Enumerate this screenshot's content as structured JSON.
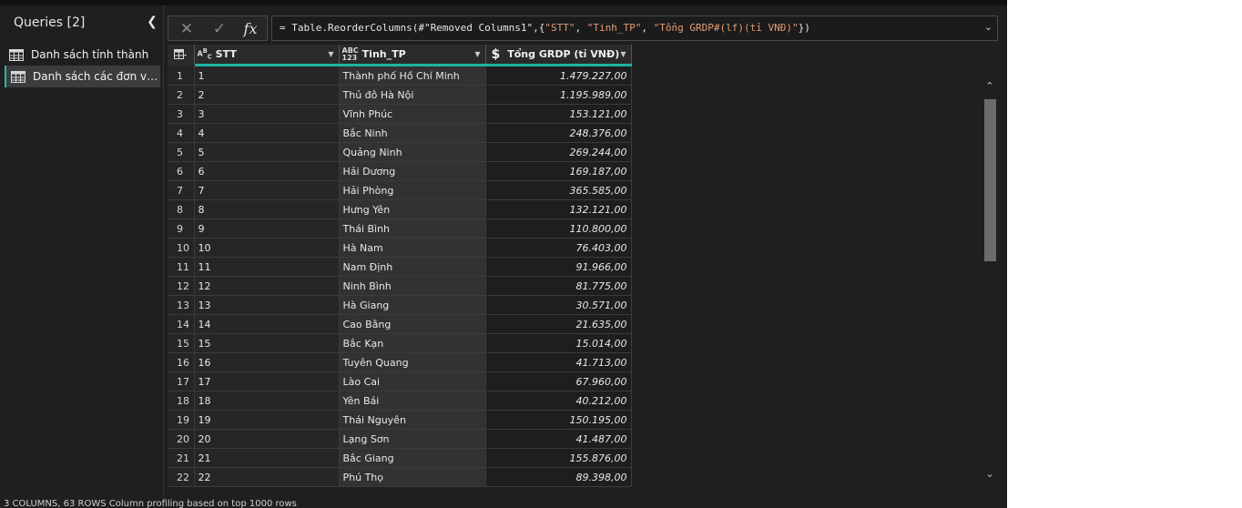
{
  "queries": {
    "title": "Queries [2]",
    "items": [
      {
        "label": "Danh sách tỉnh thành",
        "selected": false
      },
      {
        "label": "Danh sách các đơn vị hà...",
        "selected": true
      }
    ]
  },
  "formula": {
    "prefix": "= Table.ReorderColumns(#\"Removed Columns1\",{",
    "s1": "\"STT\"",
    "sep1": ", ",
    "s2": "\"Tinh_TP\"",
    "sep2": ", ",
    "s3": "\"Tổng GRDP#(lf)(tỉ VNĐ)\"",
    "suffix": "})"
  },
  "columns": {
    "stt": {
      "label": "STT",
      "type_icon": "ABC-text-icon"
    },
    "tinh": {
      "label": "Tinh_TP",
      "type_icon": "ABC-123-any-icon"
    },
    "gdp": {
      "label": "Tổng GRDP (tỉ VNĐ)",
      "type_icon": "currency-icon"
    }
  },
  "rows": [
    {
      "n": "1",
      "stt": "1",
      "tinh": "Thành phố Hồ Chí Minh",
      "gdp": "1.479.227,00"
    },
    {
      "n": "2",
      "stt": "2",
      "tinh": "Thủ đô Hà Nội",
      "gdp": "1.195.989,00"
    },
    {
      "n": "3",
      "stt": "3",
      "tinh": "Vĩnh Phúc",
      "gdp": "153.121,00"
    },
    {
      "n": "4",
      "stt": "4",
      "tinh": "Bắc Ninh",
      "gdp": "248.376,00"
    },
    {
      "n": "5",
      "stt": "5",
      "tinh": "Quảng Ninh",
      "gdp": "269.244,00"
    },
    {
      "n": "6",
      "stt": "6",
      "tinh": "Hải Dương",
      "gdp": "169.187,00"
    },
    {
      "n": "7",
      "stt": "7",
      "tinh": "Hải Phòng",
      "gdp": "365.585,00"
    },
    {
      "n": "8",
      "stt": "8",
      "tinh": "Hưng Yên",
      "gdp": "132.121,00"
    },
    {
      "n": "9",
      "stt": "9",
      "tinh": "Thái Bình",
      "gdp": "110.800,00"
    },
    {
      "n": "10",
      "stt": "10",
      "tinh": "Hà Nam",
      "gdp": "76.403,00"
    },
    {
      "n": "11",
      "stt": "11",
      "tinh": "Nam Định",
      "gdp": "91.966,00"
    },
    {
      "n": "12",
      "stt": "12",
      "tinh": "Ninh Bình",
      "gdp": "81.775,00"
    },
    {
      "n": "13",
      "stt": "13",
      "tinh": "Hà Giang",
      "gdp": "30.571,00"
    },
    {
      "n": "14",
      "stt": "14",
      "tinh": "Cao Bằng",
      "gdp": "21.635,00"
    },
    {
      "n": "15",
      "stt": "15",
      "tinh": "Bắc Kạn",
      "gdp": "15.014,00"
    },
    {
      "n": "16",
      "stt": "16",
      "tinh": "Tuyên Quang",
      "gdp": "41.713,00"
    },
    {
      "n": "17",
      "stt": "17",
      "tinh": "Lào Cai",
      "gdp": "67.960,00"
    },
    {
      "n": "18",
      "stt": "18",
      "tinh": "Yên Bái",
      "gdp": "40.212,00"
    },
    {
      "n": "19",
      "stt": "19",
      "tinh": "Thái Nguyên",
      "gdp": "150.195,00"
    },
    {
      "n": "20",
      "stt": "20",
      "tinh": "Lạng Sơn",
      "gdp": "41.487,00"
    },
    {
      "n": "21",
      "stt": "21",
      "tinh": "Bắc Giang",
      "gdp": "155.876,00"
    },
    {
      "n": "22",
      "stt": "22",
      "tinh": "Phú Thọ",
      "gdp": "89.398,00"
    }
  ],
  "status": {
    "text": "3 COLUMNS, 63 ROWS    Column profiling based on top 1000 rows"
  },
  "colors": {
    "accent": "#1fb3a3",
    "background": "#1f1f1f",
    "string": "#e49b72"
  }
}
